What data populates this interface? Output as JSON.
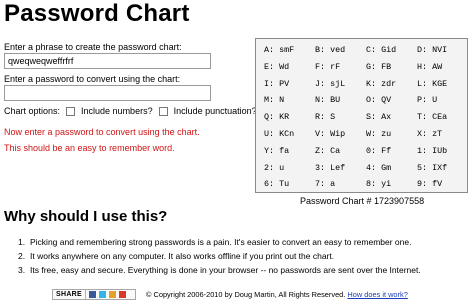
{
  "page": {
    "title": "Password Chart"
  },
  "form": {
    "phrase_label": "Enter a phrase to create the password chart:",
    "phrase_value": "qweqweqweffrfrf",
    "password_label": "Enter a password to convert using the chart:",
    "password_value": "",
    "options_label": "Chart options:",
    "include_numbers_label": "Include numbers?",
    "include_punctuation_label": "Include punctuation?",
    "include_numbers_checked": false,
    "include_punctuation_checked": false,
    "message_1": "Now enter a password to convert using the chart.",
    "message_2": "This should be an easy to remember word."
  },
  "chart": {
    "rows": [
      [
        "A: smF",
        "B: ved",
        "C: Gid",
        "D: NVI"
      ],
      [
        "E: Wd",
        "F: rF",
        "G: FB",
        "H: AW"
      ],
      [
        "I: PV",
        "J: sjL",
        "K: zdr",
        "L: KGE"
      ],
      [
        "M: N",
        "N: BU",
        "O: QV",
        "P: U"
      ],
      [
        "Q: KR",
        "R: S",
        "S: Ax",
        "T: CEa"
      ],
      [
        "U: KCn",
        "V: Wip",
        "W: zu",
        "X: zT"
      ],
      [
        "Y: fa",
        "Z: Ca",
        "0: Ff",
        "1: IUb"
      ],
      [
        "2: u",
        "3: Lef",
        "4: Gm",
        "5: IXf"
      ],
      [
        "6: Tu",
        "7: a",
        "8: yi",
        "9: fV"
      ]
    ],
    "caption": "Password Chart # 1723907558"
  },
  "why": {
    "heading": "Why should I use this?",
    "items": [
      {
        "num": "1.",
        "text": "Picking and remembering strong passwords is a pain. It's easier to convert an easy to remember one."
      },
      {
        "num": "2.",
        "text": "It works anywhere on any computer. It also works offline if you print out the chart."
      },
      {
        "num": "3.",
        "text": "Its free, easy and secure. Everything is done in your browser -- no passwords are sent over the Internet."
      }
    ]
  },
  "footer": {
    "share_label": "SHARE",
    "copyright": "© Copyright 2006-2010 by Doug Martin, All Rights Reserved.",
    "how_link": "How does it work?"
  },
  "colors": {
    "message": "#d01414",
    "link": "#1a3fb8",
    "chart_bg": "#f3f3f3"
  }
}
